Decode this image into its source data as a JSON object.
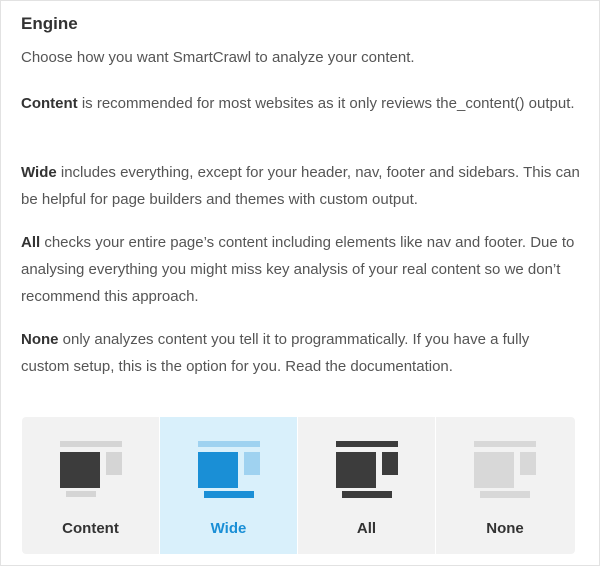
{
  "section": {
    "title": "Engine",
    "intro": "Choose how you want SmartCrawl to analyze your content.",
    "descriptions": [
      {
        "term": "Content",
        "text": " is recommended for most websites as it only reviews the_content() output."
      },
      {
        "term": "Wide",
        "text": " includes everything, except for your header, nav, footer and sidebars. This can be helpful for page builders and themes with custom output."
      },
      {
        "term": "All",
        "text": " checks your entire page’s content including elements like nav and footer. Due to analysing everything you might miss key analysis of your real content so we don’t recommend this approach."
      },
      {
        "term": "None",
        "text": " only analyzes content you tell it to programmatically. If you have a fully custom setup, this is the option for you. Read the documentation."
      }
    ]
  },
  "engine_options": [
    {
      "label": "Content",
      "icon": "layout-content-icon",
      "selected": false
    },
    {
      "label": "Wide",
      "icon": "layout-wide-icon",
      "selected": true
    },
    {
      "label": "All",
      "icon": "layout-all-icon",
      "selected": false
    },
    {
      "label": "None",
      "icon": "layout-none-icon",
      "selected": false
    }
  ],
  "colors": {
    "accent": "#1a8fd6",
    "selected_bg": "#d9f0fb",
    "selector_bg": "#f2f2f2",
    "icon_dark": "#3c3c3c",
    "icon_light": "#d5d5d5",
    "icon_blue": "#1a8fd6",
    "icon_blue_light": "#9fd2f0",
    "icon_none": "#d8d8d8"
  }
}
